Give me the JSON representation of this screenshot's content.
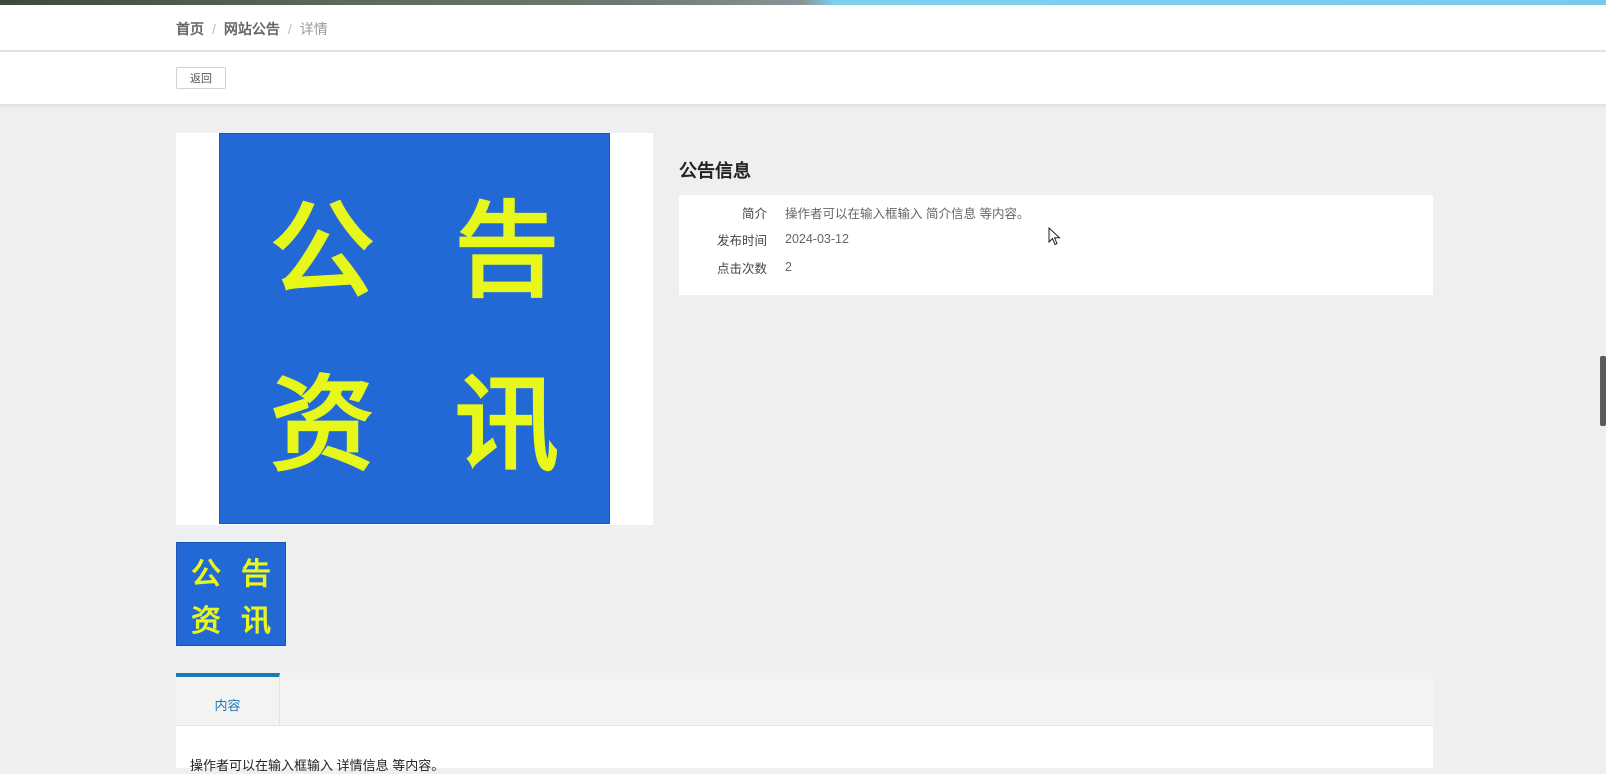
{
  "breadcrumb": {
    "home": "首页",
    "section": "网站公告",
    "current": "详情",
    "separator": "/"
  },
  "toolbar": {
    "back_label": "返回"
  },
  "poster": {
    "chars": [
      "公",
      "告",
      "资",
      "讯"
    ],
    "background_color": "#2369d5",
    "text_color": "#e7f71a"
  },
  "info": {
    "title": "公告信息",
    "rows": [
      {
        "label": "简介",
        "value": "操作者可以在输入框输入 简介信息 等内容。"
      },
      {
        "label": "发布时间",
        "value": "2024-03-12"
      },
      {
        "label": "点击次数",
        "value": "2"
      }
    ]
  },
  "tabs": [
    {
      "label": "内容",
      "active": true
    }
  ],
  "content": {
    "text": "操作者可以在输入框输入  详情信息  等内容。"
  },
  "colors": {
    "accent": "#1e79b4",
    "page_background": "#eeeff0"
  }
}
